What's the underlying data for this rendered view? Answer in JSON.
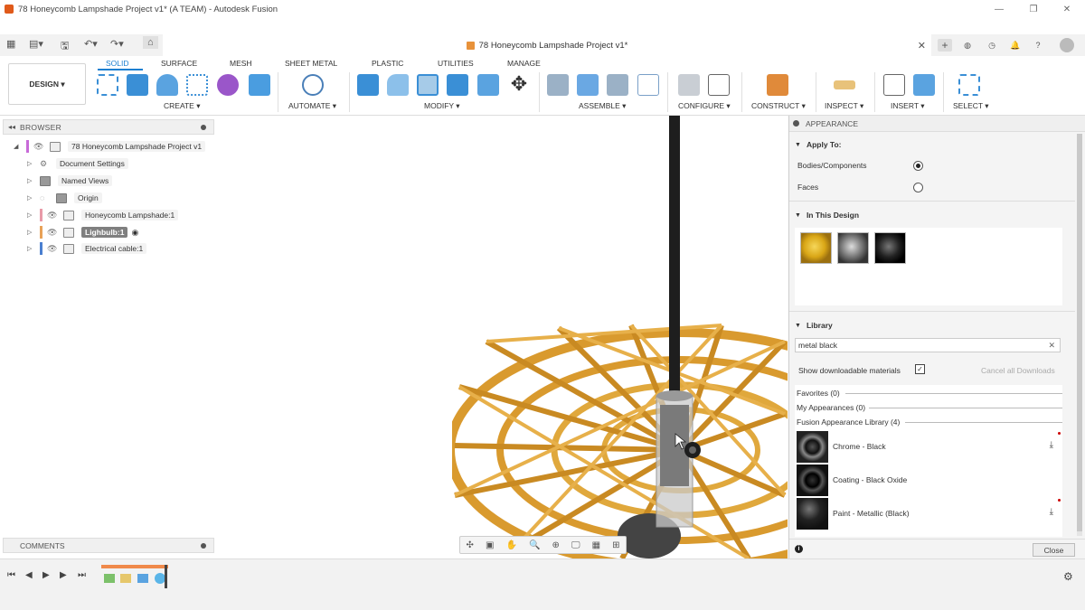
{
  "window": {
    "title": "78 Honeycomb Lampshade Project v1* (A TEAM) - Autodesk Fusion",
    "minimize": "—",
    "maximize": "❐",
    "close": "✕"
  },
  "document_tab": {
    "label": "78 Honeycomb Lampshade Project v1*",
    "close": "✕"
  },
  "workspace": {
    "mode": "DESIGN ▾",
    "tabs": [
      "SOLID",
      "SURFACE",
      "MESH",
      "SHEET METAL",
      "PLASTIC",
      "UTILITIES",
      "MANAGE"
    ],
    "active_tab": "SOLID",
    "groups": [
      "CREATE ▾",
      "AUTOMATE ▾",
      "MODIFY ▾",
      "ASSEMBLE ▾",
      "CONFIGURE ▾",
      "CONSTRUCT ▾",
      "INSPECT ▾",
      "INSERT ▾",
      "SELECT ▾"
    ]
  },
  "browser": {
    "title": "BROWSER",
    "items": [
      {
        "label": "78 Honeycomb Lampshade Project v1"
      },
      {
        "label": "Document Settings"
      },
      {
        "label": "Named Views"
      },
      {
        "label": "Origin"
      },
      {
        "label": "Honeycomb Lampshade:1"
      },
      {
        "label": "Lighbulb:1"
      },
      {
        "label": "Electrical cable:1"
      }
    ]
  },
  "comments": {
    "title": "COMMENTS"
  },
  "appearance": {
    "title": "APPEARANCE",
    "apply_to": {
      "title": "Apply To:",
      "options": [
        "Bodies/Components",
        "Faces"
      ],
      "selected": "Bodies/Components"
    },
    "in_this_design": {
      "title": "In This Design"
    },
    "library": {
      "title": "Library",
      "search_value": "metal black",
      "show_downloadable_label": "Show downloadable materials",
      "show_downloadable_checked": true,
      "cancel_downloads": "Cancel all Downloads",
      "categories": [
        "Favorites (0)",
        "My Appearances (0)",
        "Fusion Appearance Library (4)"
      ],
      "materials": [
        {
          "name": "Chrome - Black",
          "downloadable": true
        },
        {
          "name": "Coating - Black Oxide",
          "downloadable": false
        },
        {
          "name": "Paint - Metallic (Black)",
          "downloadable": true
        }
      ]
    },
    "close_label": "Close"
  },
  "icons": {
    "grid": "grid-icon",
    "save": "save-icon",
    "undo": "undo-icon",
    "redo": "redo-icon",
    "home": "home-icon",
    "info": "info-icon",
    "gear": "gear-icon"
  },
  "colors": {
    "accent": "#1a7fd1",
    "lampshade": "#d99a2e",
    "cable": "#1e1e1e"
  }
}
